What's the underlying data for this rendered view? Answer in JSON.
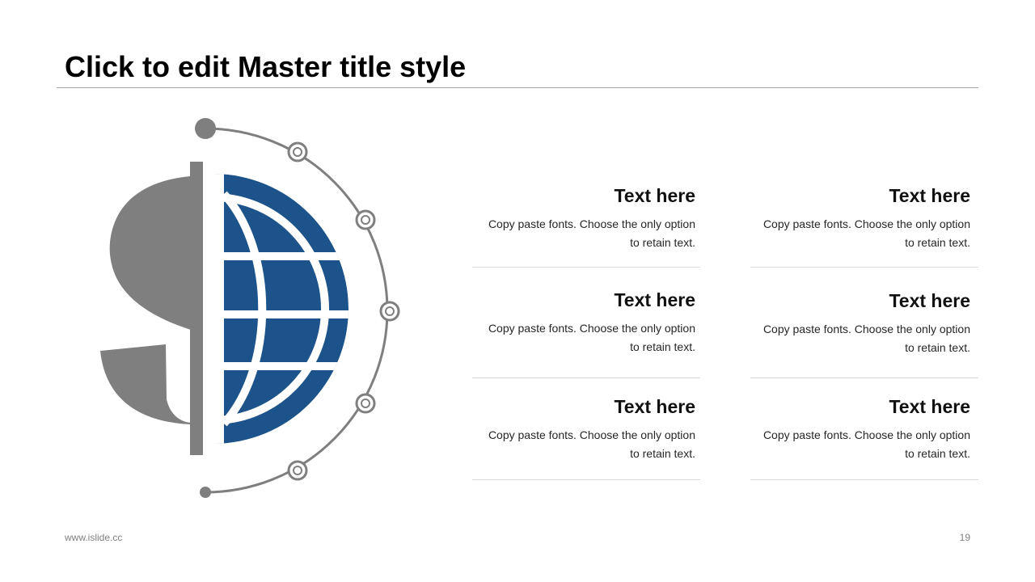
{
  "slide": {
    "title": "Click to edit Master title style",
    "footer_url": "www.islide.cc",
    "page_number": "19"
  },
  "colors": {
    "accent_blue": "#1b538a",
    "gray": "#7f7f7f"
  },
  "graphic": {
    "icon": "dollar-globe-icon"
  },
  "items": [
    {
      "title": "Text here",
      "body": "Copy paste fonts. Choose the only option to retain text."
    },
    {
      "title": "Text here",
      "body": "Copy paste fonts. Choose the only option to retain text."
    },
    {
      "title": "Text here",
      "body": "Copy paste fonts. Choose the only option to retain text."
    },
    {
      "title": "Text here",
      "body": "Copy paste fonts. Choose the only option to retain text."
    },
    {
      "title": "Text here",
      "body": "Copy paste fonts. Choose the only option to retain text."
    },
    {
      "title": "Text here",
      "body": "Copy paste fonts. Choose the only option to retain text."
    }
  ]
}
